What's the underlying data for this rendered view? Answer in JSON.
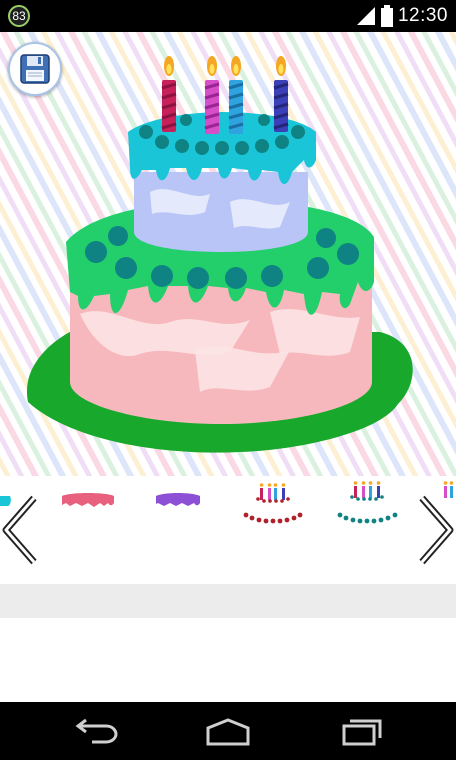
{
  "status_bar": {
    "notification_count": "83",
    "time": "12:30",
    "icons": [
      "signal-icon",
      "battery-icon"
    ]
  },
  "toolbar": {
    "save_icon": "floppy-disk-icon"
  },
  "cake": {
    "candle_colors": [
      "#c7215a",
      "#d64fc9",
      "#2ea3e0",
      "#3b3fb8"
    ],
    "top_tier_color": "#b9c4f7",
    "top_frosting_color": "#19c5d6",
    "bottom_tier_color": "#f7b8bd",
    "bottom_frosting_color": "#22cf6a",
    "bead_color": "#0f8383",
    "plate_color": "#18a82c"
  },
  "picker": {
    "prev_icon": "chevron-left-icon",
    "next_icon": "chevron-right-icon",
    "items": [
      {
        "name": "cyan-frosting",
        "color": "#19c5d6"
      },
      {
        "name": "pink-frosting",
        "color": "#e8607e"
      },
      {
        "name": "purple-frosting",
        "color": "#8c4fd6"
      },
      {
        "name": "red-candles-beads",
        "color": "#b0202a"
      },
      {
        "name": "teal-candles-beads",
        "color": "#0f8383"
      },
      {
        "name": "partial-candles",
        "color": "#d64fc9"
      }
    ]
  },
  "nav_bar": {
    "buttons": [
      "back-icon",
      "home-icon",
      "recents-icon"
    ]
  }
}
